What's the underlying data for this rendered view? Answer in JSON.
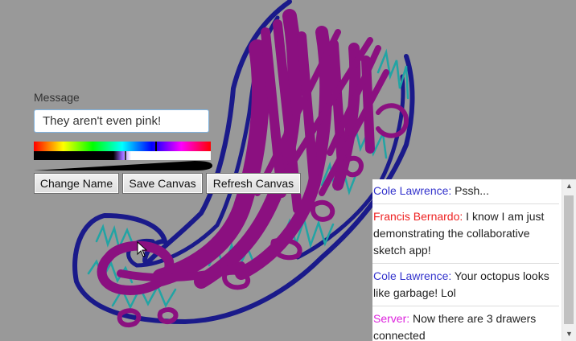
{
  "message": {
    "label": "Message",
    "value": "They aren't even pink!"
  },
  "buttons": {
    "change_name": "Change Name",
    "save_canvas": "Save Canvas",
    "refresh_canvas": "Refresh Canvas"
  },
  "chat": {
    "messages": [
      {
        "name": "Cole Lawrence:",
        "name_color": "#3333cc",
        "text": "Pssh..."
      },
      {
        "name": "Francis Bernardo:",
        "name_color": "#ee2222",
        "text": "I know I am just demonstrating the collaborative sketch app!"
      },
      {
        "name": "Cole Lawrence:",
        "name_color": "#3333cc",
        "text": "Your octopus looks like garbage! Lol"
      },
      {
        "name": "Server:",
        "name_color": "#dd22dd",
        "text": "Now there are 3 drawers connected"
      }
    ]
  },
  "colors": {
    "background": "#999999",
    "stroke_purple": "#8b1080",
    "stroke_navy": "#1a1a8a",
    "stroke_teal": "#22a4a4"
  }
}
